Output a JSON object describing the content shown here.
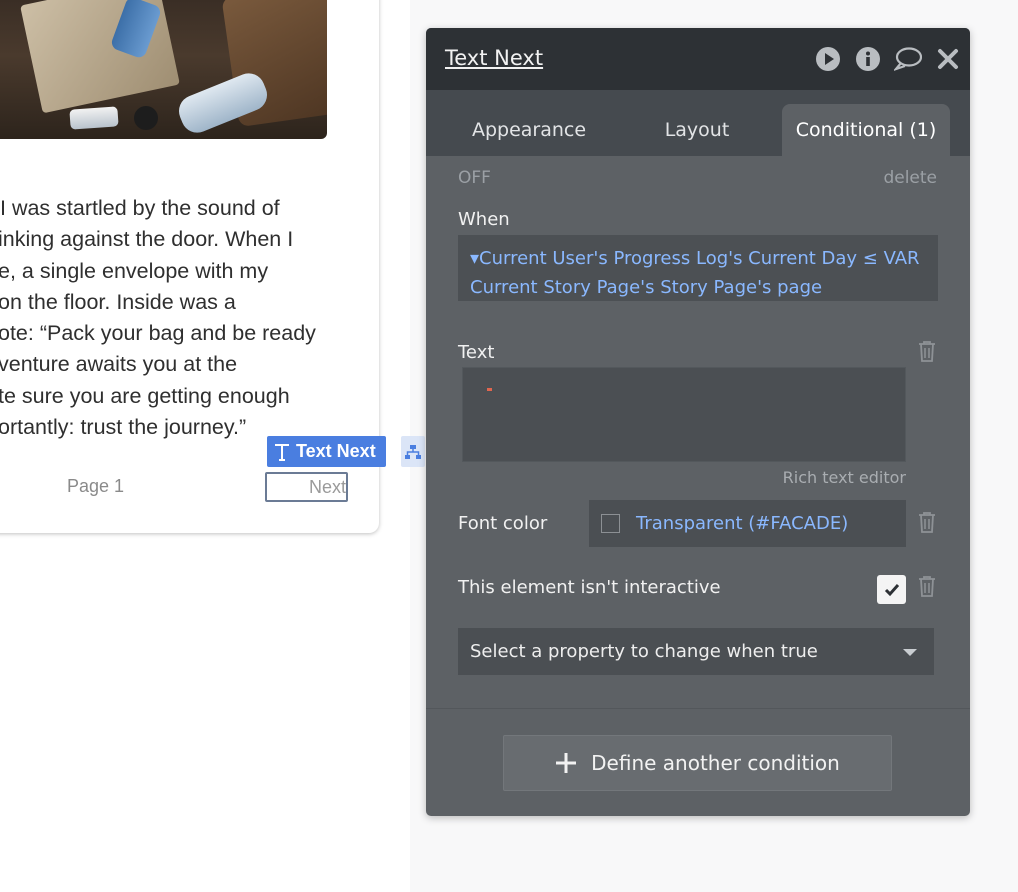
{
  "story": {
    "lines": [
      "I was startled by the sound of",
      "inking against the door. When I",
      "e, a single envelope with my",
      "on the floor. Inside was a",
      "ote: “Pack your bag and be ready",
      "venture awaits you at the",
      "te sure you are getting enough",
      "ortantly: trust the journey.”"
    ],
    "page_label": "Page 1",
    "next_label": "Next",
    "selected_tag": "Text Next"
  },
  "editor": {
    "title": "Text Next",
    "icons": [
      "play-icon",
      "info-icon",
      "comment-icon",
      "close-icon"
    ],
    "tabs": [
      {
        "label": "Appearance",
        "active": false
      },
      {
        "label": "Layout",
        "active": false
      },
      {
        "label": "Conditional (1)",
        "active": true
      }
    ],
    "status": "OFF",
    "delete_label": "delete",
    "when_label": "When",
    "when_expression_line1": "▾Current User's Progress Log's Current Day ≤ VAR",
    "when_expression_line2": "Current Story Page's Story Page's page",
    "text_label": "Text",
    "rich_text_label": "Rich text editor",
    "font_color_label": "Font color",
    "font_color_value": "Transparent (#FACADE)",
    "interactive_label": "This element isn't interactive",
    "interactive_checked": true,
    "select_property_placeholder": "Select a property to change when true",
    "define_button_label": "Define another condition"
  },
  "colors": {
    "accent_blue": "#4a7ee0",
    "link_blue": "#8ab8ff",
    "panel_bg": "#5d6165",
    "header_bg": "#2d3135"
  }
}
